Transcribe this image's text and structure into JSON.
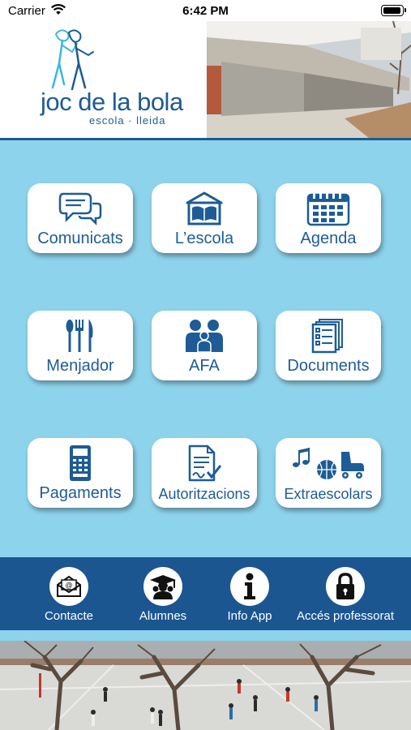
{
  "status_bar": {
    "carrier": "Carrier",
    "time": "6:42 PM"
  },
  "header": {
    "logo_title": "joc de la bola",
    "logo_subtitle": "escola · lleida"
  },
  "colors": {
    "primary": "#1d5c96",
    "bar": "#1b5691",
    "background": "#8ed3ec"
  },
  "menu": [
    {
      "label": "Comunicats",
      "icon": "chat-bubbles-icon"
    },
    {
      "label": "L’escola",
      "icon": "book-building-icon"
    },
    {
      "label": "Agenda",
      "icon": "calendar-icon"
    },
    {
      "label": "Menjador",
      "icon": "cutlery-icon"
    },
    {
      "label": "AFA",
      "icon": "family-icon"
    },
    {
      "label": "Documents",
      "icon": "documents-icon"
    },
    {
      "label": "Pagaments",
      "icon": "payment-terminal-icon"
    },
    {
      "label": "Autoritzacions",
      "icon": "signed-document-icon"
    },
    {
      "label": "Extraescolars",
      "icon": "music-ball-skate-icon"
    }
  ],
  "bottom_bar": [
    {
      "label": "Contacte",
      "icon": "email-icon"
    },
    {
      "label": "Alumnes",
      "icon": "graduate-icon"
    },
    {
      "label": "Info App",
      "icon": "info-icon"
    },
    {
      "label": "Accés professorat",
      "icon": "lock-icon"
    }
  ]
}
